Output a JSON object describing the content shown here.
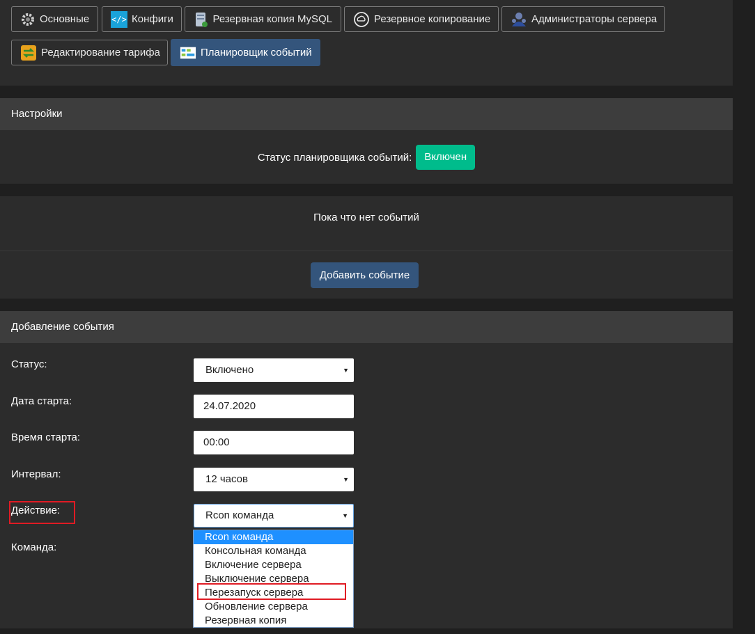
{
  "tabs": [
    {
      "label": "Основные",
      "icon": "gear-icon"
    },
    {
      "label": "Конфиги",
      "icon": "code-icon"
    },
    {
      "label": "Резервная копия MySQL",
      "icon": "database-icon"
    },
    {
      "label": "Резервное копирование",
      "icon": "cloud-backup-icon"
    },
    {
      "label": "Администраторы сервера",
      "icon": "admins-icon"
    },
    {
      "label": "Редактирование тарифа",
      "icon": "swap-icon"
    },
    {
      "label": "Планировщик событий",
      "icon": "scheduler-icon",
      "active": true
    }
  ],
  "settings": {
    "title": "Настройки",
    "status_label": "Статус планировщика событий:",
    "status_value": "Включен"
  },
  "events": {
    "empty_text": "Пока что нет событий",
    "add_button": "Добавить событие"
  },
  "add_event": {
    "title": "Добавление события",
    "status_label": "Статус:",
    "status_value": "Включено",
    "date_label": "Дата старта:",
    "date_value": "24.07.2020",
    "time_label": "Время старта:",
    "time_value": "00:00",
    "interval_label": "Интервал:",
    "interval_value": "12 часов",
    "action_label": "Действие:",
    "action_value": "Rcon команда",
    "command_label": "Команда:",
    "action_options": [
      "Rcon команда",
      "Консольная команда",
      "Включение сервера",
      "Выключение сервера",
      "Перезапуск сервера",
      "Обновление сервера",
      "Резервная копия"
    ]
  },
  "colors": {
    "background": "#1f1f1f",
    "panel": "#2c2c2c",
    "panel_header": "#3d3d3d",
    "primary": "#34557c",
    "success": "#00bc8c",
    "highlight": "#1e90ff",
    "annotation": "#e01b24"
  }
}
